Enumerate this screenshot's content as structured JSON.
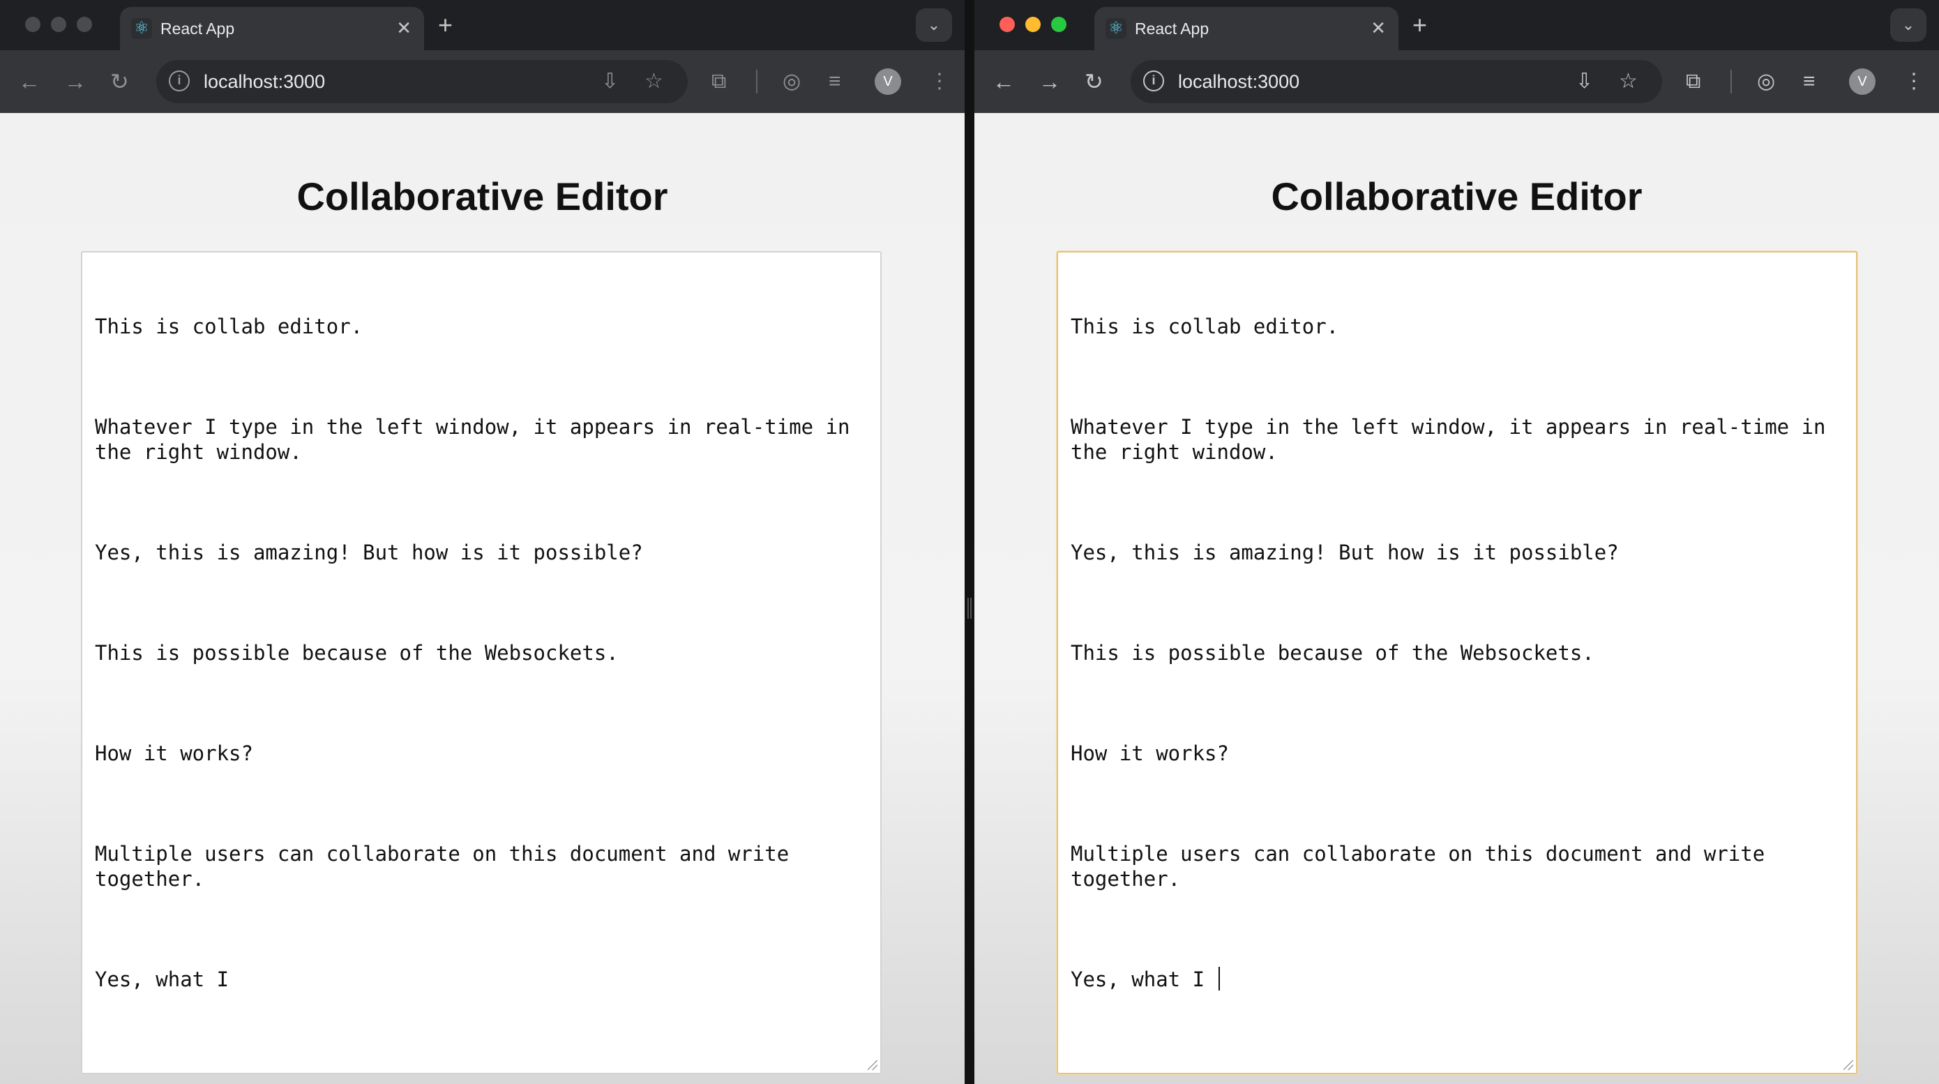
{
  "windows": [
    {
      "id": "left",
      "tab": {
        "title": "React App",
        "close": "✕",
        "favicon": "react-icon"
      },
      "new_tab": "+",
      "tab_search": "⌄",
      "toolbar": {
        "back": "←",
        "forward": "→",
        "reload": "↻",
        "info": "i",
        "url": "localhost:3000",
        "install_icon": "install-app-icon",
        "bookmark_icon": "star-icon",
        "extensions_icon": "puzzle-icon",
        "avatar": "V",
        "menu": "⋮"
      },
      "page": {
        "title": "Collaborative Editor",
        "editor_paragraphs": [
          "This is collab editor.",
          "Whatever I type in the left window, it appears in real-time in the right window.",
          "Yes, this is amazing! But how is it possible?",
          "This is possible because of the Websockets.",
          "How it works?",
          "Multiple users can collaborate on this document and write together.",
          "Yes, what I"
        ],
        "focused": false
      }
    },
    {
      "id": "right",
      "tab": {
        "title": "React App",
        "close": "✕",
        "favicon": "react-icon"
      },
      "new_tab": "+",
      "tab_search": "⌄",
      "toolbar": {
        "back": "←",
        "forward": "→",
        "reload": "↻",
        "info": "i",
        "url": "localhost:3000",
        "install_icon": "install-app-icon",
        "bookmark_icon": "star-icon",
        "extensions_icon": "puzzle-icon",
        "avatar": "V",
        "menu": "⋮"
      },
      "page": {
        "title": "Collaborative Editor",
        "editor_paragraphs": [
          "This is collab editor.",
          "Whatever I type in the left window, it appears in real-time in the right window.",
          "Yes, this is amazing! But how is it possible?",
          "This is possible because of the Websockets.",
          "How it works?",
          "Multiple users can collaborate on this document and write together.",
          "Yes, what I "
        ],
        "focused": true
      }
    }
  ],
  "colors": {
    "focus_border": "#e6c27a",
    "traffic_red": "#ff5f57",
    "traffic_yellow": "#febc2e",
    "traffic_green": "#28c840"
  }
}
